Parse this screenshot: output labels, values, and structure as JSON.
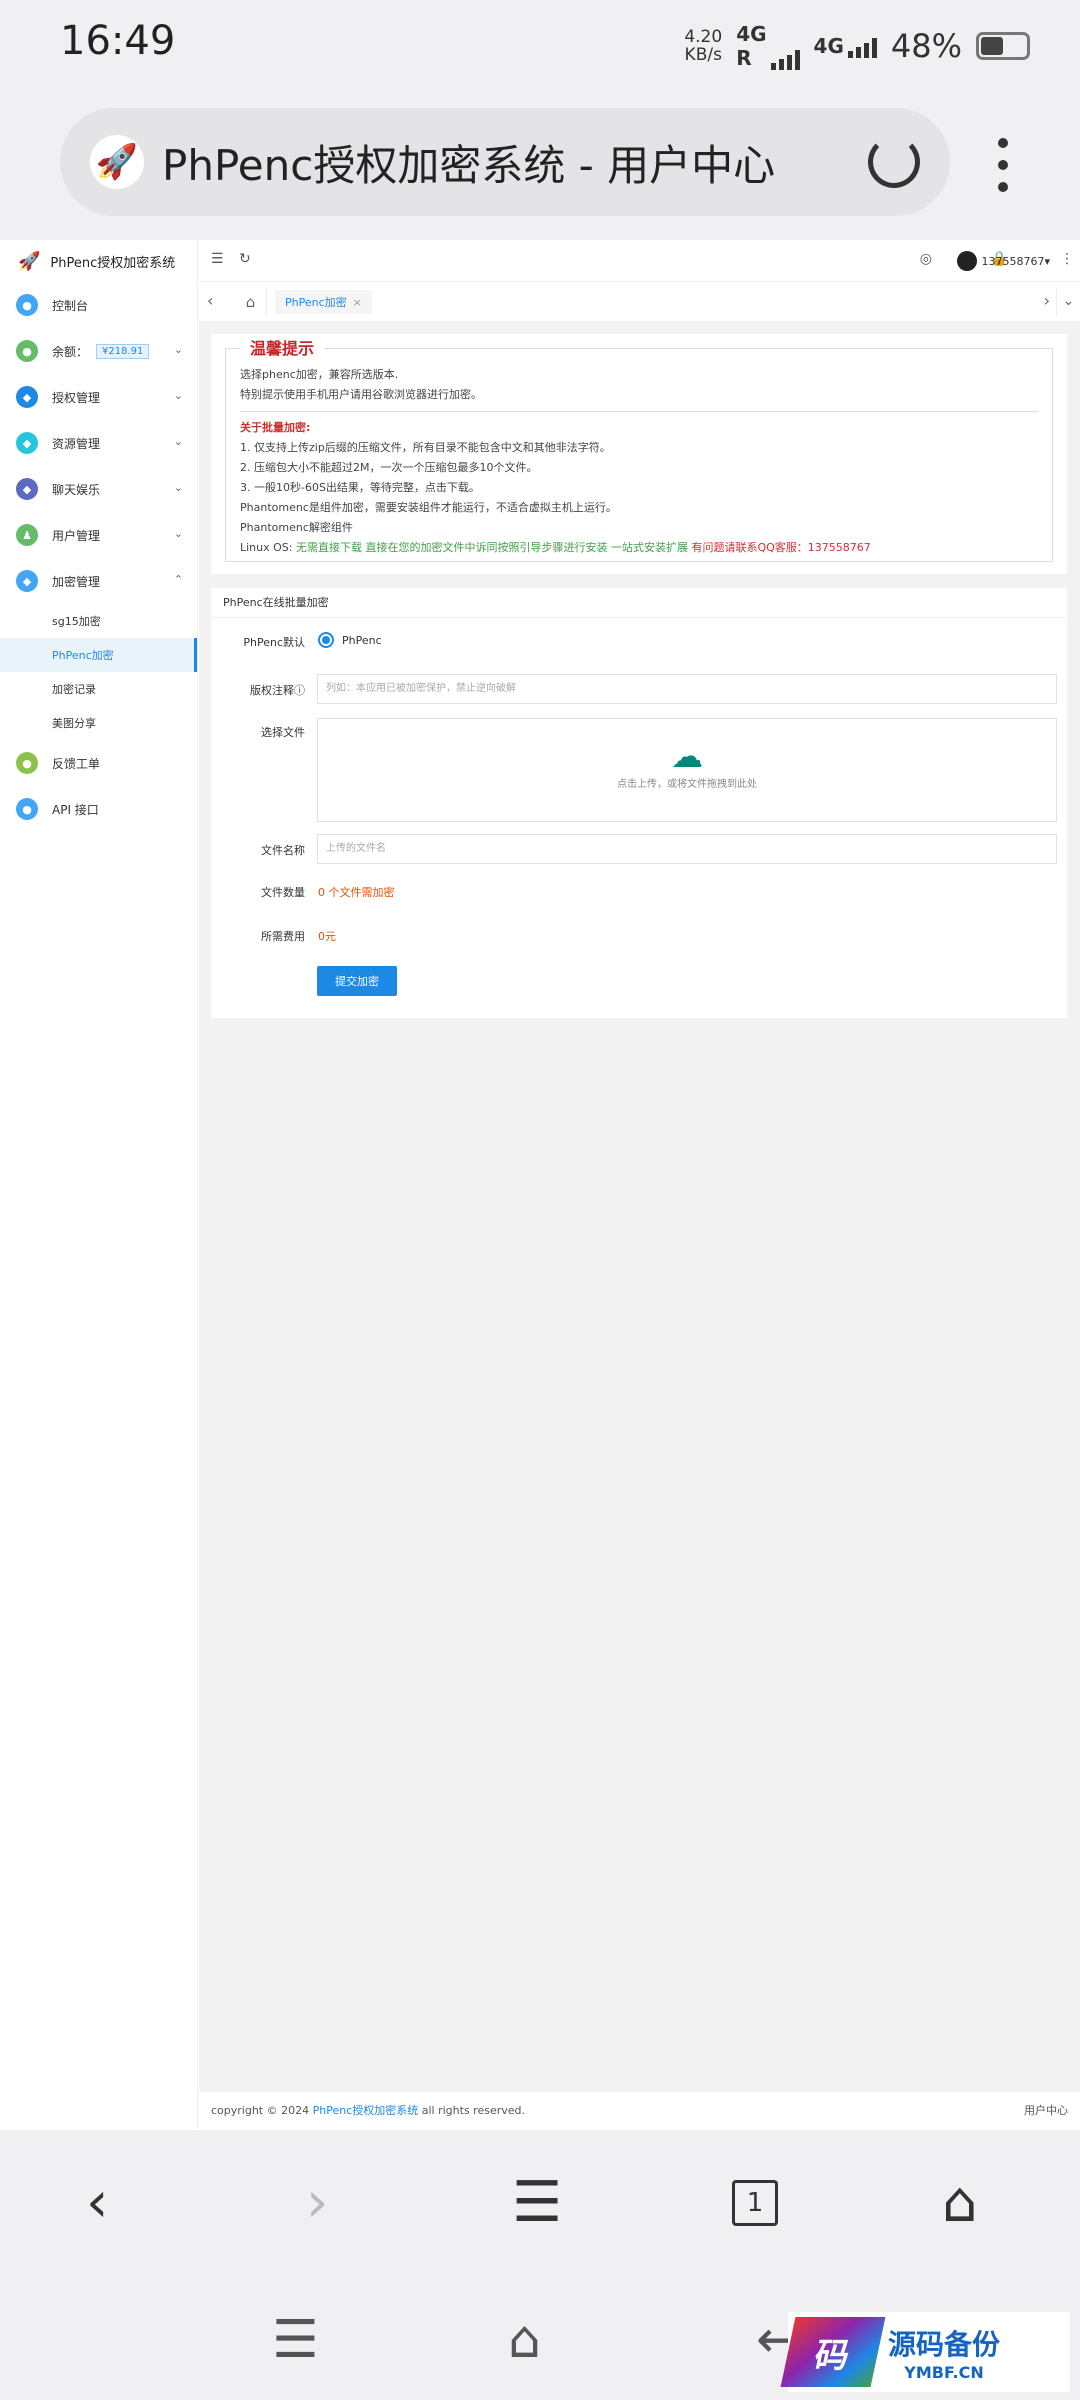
{
  "status_bar": {
    "time": "16:49",
    "speed_value": "4.20",
    "speed_unit": "KB/s",
    "net1": "4G",
    "net1_sub": "R",
    "net2": "4G",
    "battery": "48%"
  },
  "browser": {
    "title": "PhPenc授权加密系统 - 用户中心",
    "tab_count": "1"
  },
  "sidebar": {
    "brand": "PhPenc授权加密系统",
    "items": [
      {
        "label": "控制台",
        "color": "#42a5f5"
      },
      {
        "label": "余额：",
        "badge": "¥218.91",
        "color": "#66bb6a"
      },
      {
        "label": "授权管理",
        "color": "#1e88e5"
      },
      {
        "label": "资源管理",
        "color": "#26c6da"
      },
      {
        "label": "聊天娱乐",
        "color": "#5c6bc0"
      },
      {
        "label": "用户管理",
        "color": "#66bb6a"
      },
      {
        "label": "加密管理",
        "color": "#42a5f5"
      }
    ],
    "sub_items": [
      "sg15加密",
      "PhPenc加密",
      "加密记录",
      "美图分享"
    ],
    "items2": [
      {
        "label": "反馈工单",
        "color": "#8bc34a"
      },
      {
        "label": "API 接口",
        "color": "#42a5f5"
      }
    ]
  },
  "topbar": {
    "user": "137558767"
  },
  "tabs": {
    "active": "PhPenc加密",
    "close": "×"
  },
  "notice": {
    "legend": "温馨提示",
    "line1": "选择phenc加密，兼容所选版本.",
    "line2": "特别提示使用手机用户请用谷歌浏览器进行加密。",
    "batch_title": "关于批量加密:",
    "b1": "1. 仅支持上传zip后缀的压缩文件，所有目录不能包含中文和其他非法字符。",
    "b2": "2. 压缩包大小不能超过2M，一次一个压缩包最多10个文件。",
    "b3": "3. 一般10秒-60S出结果，等待完整，点击下载。",
    "b4": "Phantomenc是组件加密，需要安装组件才能运行，不适合虚拟主机上运行。",
    "b5": "Phantomenc解密组件",
    "linux_prefix": "Linux OS: ",
    "linux_green": "无需直接下载 直接在您的加密文件中诉同按照引导步骤进行安装 一站式安装扩展",
    "linux_red": " 有问题请联系QQ客服：137558767"
  },
  "form": {
    "title": "PhPenc在线批量加密",
    "default_label": "PhPenc默认",
    "default_value": "PhPenc",
    "copyright_label": "版权注释",
    "copyright_placeholder": "列如：本应用已被加密保护，禁止逆向破解",
    "file_label": "选择文件",
    "upload_text": "点击上传，或将文件拖拽到此处",
    "filename_label": "文件名称",
    "filename_placeholder": "上传的文件名",
    "count_label": "文件数量",
    "count_value": "0 个文件需加密",
    "fee_label": "所需费用",
    "fee_value": "0元",
    "submit": "提交加密"
  },
  "footer": {
    "prefix": "copyright © 2024 ",
    "link": "PhPenc授权加密系统",
    "suffix": " all rights reserved.",
    "right": "用户中心"
  },
  "watermark": {
    "logo": "码",
    "cn": "源码备份",
    "en": "YMBF.CN"
  }
}
